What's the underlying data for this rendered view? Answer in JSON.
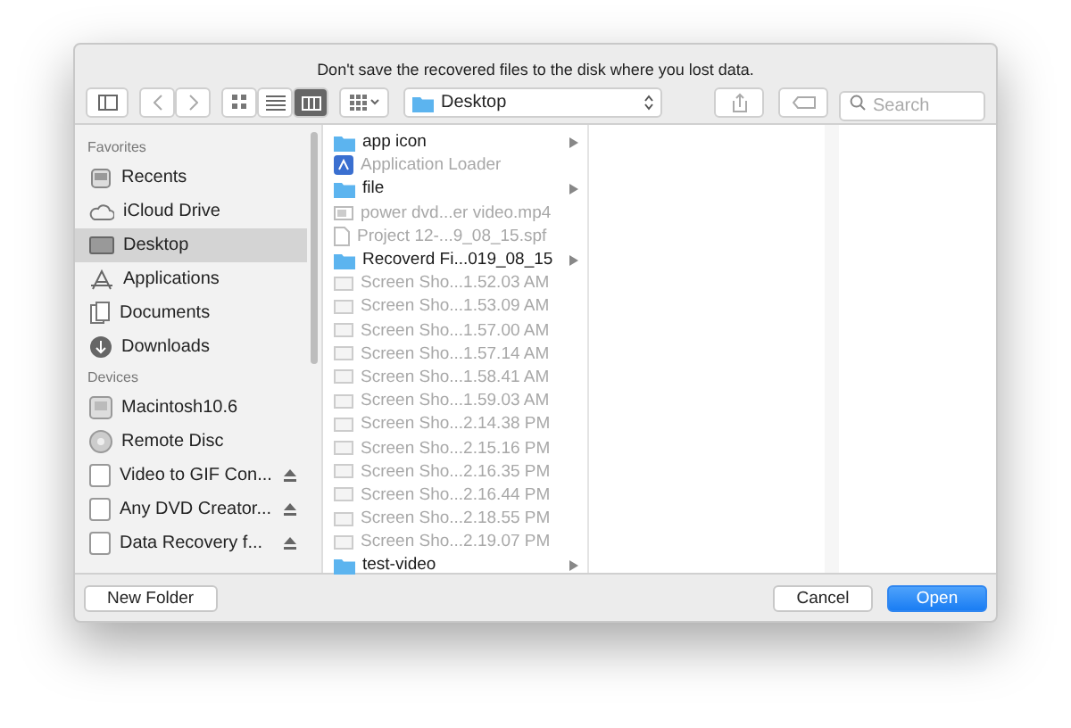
{
  "message": "Don't save the recovered files to the disk where you lost data.",
  "toolbar": {
    "views": [
      {
        "kind": "icons",
        "selected": false
      },
      {
        "kind": "list",
        "selected": false
      },
      {
        "kind": "columns",
        "selected": true
      }
    ],
    "location": "Desktop",
    "search": {
      "placeholder": "Search"
    }
  },
  "sidebar": {
    "sections": [
      {
        "title": "Favorites",
        "items": [
          {
            "label": "Recents",
            "kind": "recents",
            "selected": false,
            "eject": false
          },
          {
            "label": "iCloud Drive",
            "kind": "cloud",
            "selected": false,
            "eject": false
          },
          {
            "label": "Desktop",
            "kind": "desktop",
            "selected": true,
            "eject": false
          },
          {
            "label": "Applications",
            "kind": "apps",
            "selected": false,
            "eject": false
          },
          {
            "label": "Documents",
            "kind": "docs",
            "selected": false,
            "eject": false
          },
          {
            "label": "Downloads",
            "kind": "download",
            "selected": false,
            "eject": false
          }
        ]
      },
      {
        "title": "Devices",
        "items": [
          {
            "label": "Macintosh10.6",
            "kind": "disk",
            "selected": false,
            "eject": false
          },
          {
            "label": "Remote Disc",
            "kind": "disc",
            "selected": false,
            "eject": false
          },
          {
            "label": "Video to GIF Con...",
            "kind": "volume",
            "selected": false,
            "eject": true
          },
          {
            "label": "Any DVD Creator...",
            "kind": "volume",
            "selected": false,
            "eject": true
          },
          {
            "label": "Data Recovery f...",
            "kind": "volume",
            "selected": false,
            "eject": true
          }
        ]
      }
    ]
  },
  "files": [
    {
      "name": "app icon",
      "kind": "folder",
      "disabled": false
    },
    {
      "name": "Application Loader",
      "kind": "app",
      "disabled": true
    },
    {
      "name": "file",
      "kind": "folder",
      "disabled": false
    },
    {
      "name": "power dvd...er video.mp4",
      "kind": "video",
      "disabled": true
    },
    {
      "name": "Project 12-...9_08_15.spf",
      "kind": "doc",
      "disabled": true
    },
    {
      "name": "Recoverd Fi...019_08_15",
      "kind": "folder",
      "disabled": false
    },
    {
      "name": "Screen Sho...1.52.03 AM",
      "kind": "image",
      "disabled": true
    },
    {
      "name": "Screen Sho...1.53.09 AM",
      "kind": "image",
      "disabled": true
    },
    {
      "name": "Screen Sho...1.57.00 AM",
      "kind": "image",
      "disabled": true
    },
    {
      "name": "Screen Sho...1.57.14 AM",
      "kind": "image",
      "disabled": true
    },
    {
      "name": "Screen Sho...1.58.41 AM",
      "kind": "image",
      "disabled": true
    },
    {
      "name": "Screen Sho...1.59.03 AM",
      "kind": "image",
      "disabled": true
    },
    {
      "name": "Screen Sho...2.14.38 PM",
      "kind": "image",
      "disabled": true
    },
    {
      "name": "Screen Sho...2.15.16 PM",
      "kind": "image",
      "disabled": true
    },
    {
      "name": "Screen Sho...2.16.35 PM",
      "kind": "image",
      "disabled": true
    },
    {
      "name": "Screen Sho...2.16.44 PM",
      "kind": "image",
      "disabled": true
    },
    {
      "name": "Screen Sho...2.18.55 PM",
      "kind": "image",
      "disabled": true
    },
    {
      "name": "Screen Sho...2.19.07 PM",
      "kind": "image",
      "disabled": true
    },
    {
      "name": "test-video",
      "kind": "folder",
      "disabled": false
    }
  ],
  "footer": {
    "buttons": [
      {
        "label": "New Folder",
        "kind": "plain"
      },
      {
        "label": "Cancel",
        "kind": "plain"
      },
      {
        "label": "Open",
        "kind": "default"
      }
    ]
  }
}
